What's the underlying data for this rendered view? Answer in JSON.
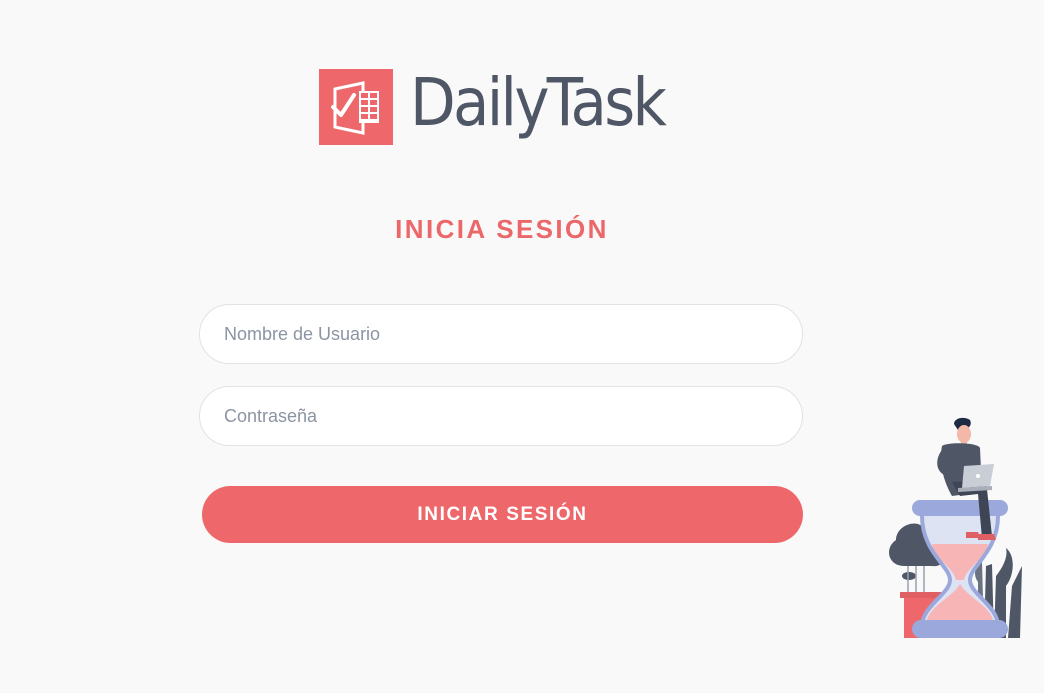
{
  "brand": {
    "name": "DailyTask",
    "logo_icon": "task-sheet-checkmark-icon",
    "accent_color": "#ee686b",
    "text_color": "#4f5766"
  },
  "login": {
    "title": "INICIA SESIÓN",
    "username": {
      "value": "",
      "placeholder": "Nombre de Usuario"
    },
    "password": {
      "value": "",
      "placeholder": "Contraseña"
    },
    "submit_label": "INICIAR SESIÓN"
  },
  "illustration": {
    "icon": "person-on-hourglass-illustration"
  }
}
